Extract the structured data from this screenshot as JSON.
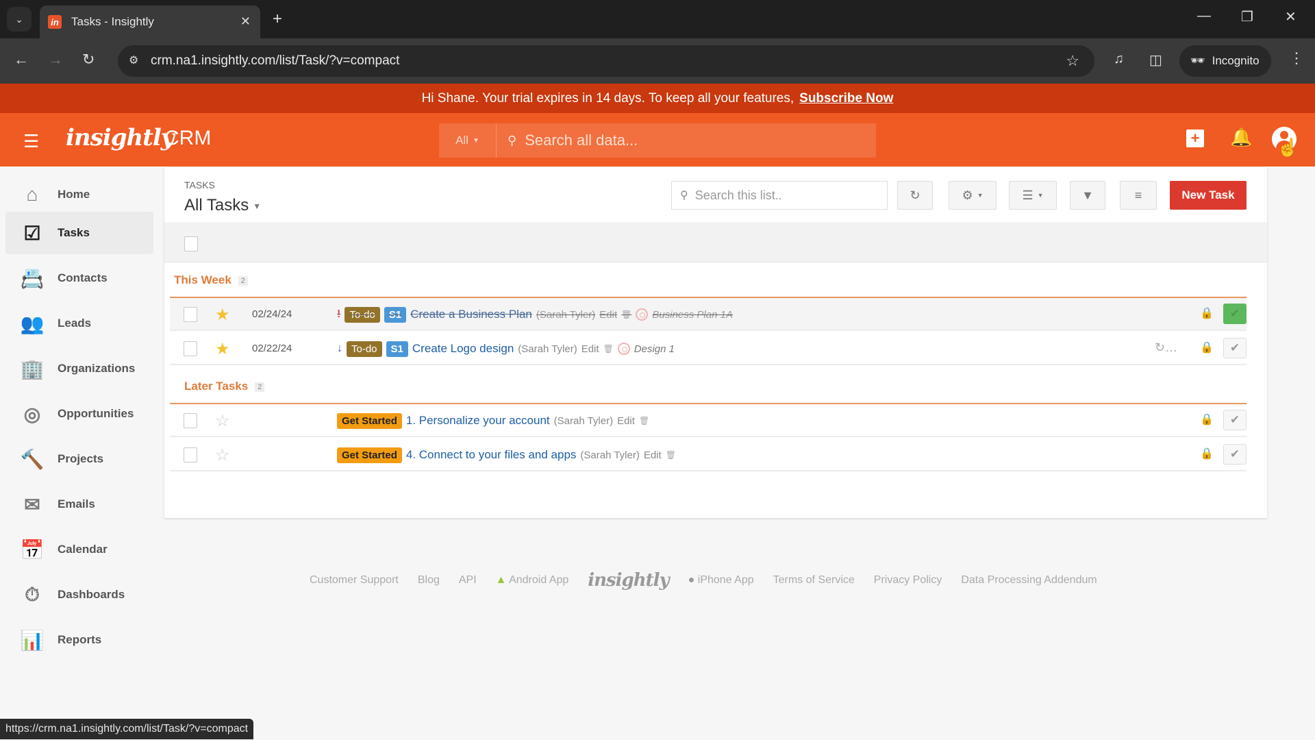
{
  "browser": {
    "tab_title": "Tasks - Insightly",
    "favicon_letter": "in",
    "url": "crm.na1.insightly.com/list/Task/?v=compact",
    "incognito_label": "Incognito",
    "status_url": "https://crm.na1.insightly.com/list/Task/?v=compact"
  },
  "banner": {
    "message": "Hi Shane. Your trial expires in 14 days. To keep all your features,",
    "link_label": "Subscribe Now"
  },
  "appbar": {
    "logo": "insightly",
    "product": "CRM",
    "search_scope": "All",
    "search_placeholder": "Search all data...",
    "brand_color": "#f05a23"
  },
  "sidebar": {
    "items": [
      {
        "label": "Home",
        "icon": "home-icon"
      },
      {
        "label": "Tasks",
        "icon": "tasks-icon",
        "active": true
      },
      {
        "label": "Contacts",
        "icon": "contacts-icon"
      },
      {
        "label": "Leads",
        "icon": "leads-icon"
      },
      {
        "label": "Organizations",
        "icon": "organizations-icon"
      },
      {
        "label": "Opportunities",
        "icon": "opportunities-icon"
      },
      {
        "label": "Projects",
        "icon": "projects-icon"
      },
      {
        "label": "Emails",
        "icon": "emails-icon"
      },
      {
        "label": "Calendar",
        "icon": "calendar-icon"
      },
      {
        "label": "Dashboards",
        "icon": "dashboards-icon"
      },
      {
        "label": "Reports",
        "icon": "reports-icon"
      }
    ]
  },
  "list": {
    "breadcrumb": "TASKS",
    "view_name": "All Tasks",
    "search_placeholder": "Search this list..",
    "new_task_label": "New Task",
    "groups": [
      {
        "title": "This Week",
        "count": "2",
        "rows": [
          {
            "starred": true,
            "date": "02/24/24",
            "priority": "high",
            "status": "To-do",
            "stage": "S1",
            "title": "Create a Business Plan",
            "owner": "(Sarah Tyler)",
            "edit": "Edit",
            "opportunity": "Business Plan 1A",
            "completed": true
          },
          {
            "starred": true,
            "date": "02/22/24",
            "priority": "low",
            "status": "To-do",
            "stage": "S1",
            "title": "Create Logo design",
            "owner": "(Sarah Tyler)",
            "edit": "Edit",
            "opportunity": "Design 1",
            "recurring": true,
            "completed": false
          }
        ]
      },
      {
        "title": "Later Tasks",
        "count": "2",
        "rows": [
          {
            "starred": false,
            "date": "",
            "category": "Get Started",
            "title": "1. Personalize your account",
            "owner": "(Sarah Tyler)",
            "edit": "Edit",
            "completed": false
          },
          {
            "starred": false,
            "date": "",
            "category": "Get Started",
            "title": "4. Connect to your files and apps",
            "owner": "(Sarah Tyler)",
            "edit": "Edit",
            "completed": false
          }
        ]
      }
    ]
  },
  "footer": {
    "links": [
      "Customer Support",
      "Blog",
      "API",
      "Android App",
      "iPhone App",
      "Terms of Service",
      "Privacy Policy",
      "Data Processing Addendum"
    ],
    "logo": "insightly"
  }
}
